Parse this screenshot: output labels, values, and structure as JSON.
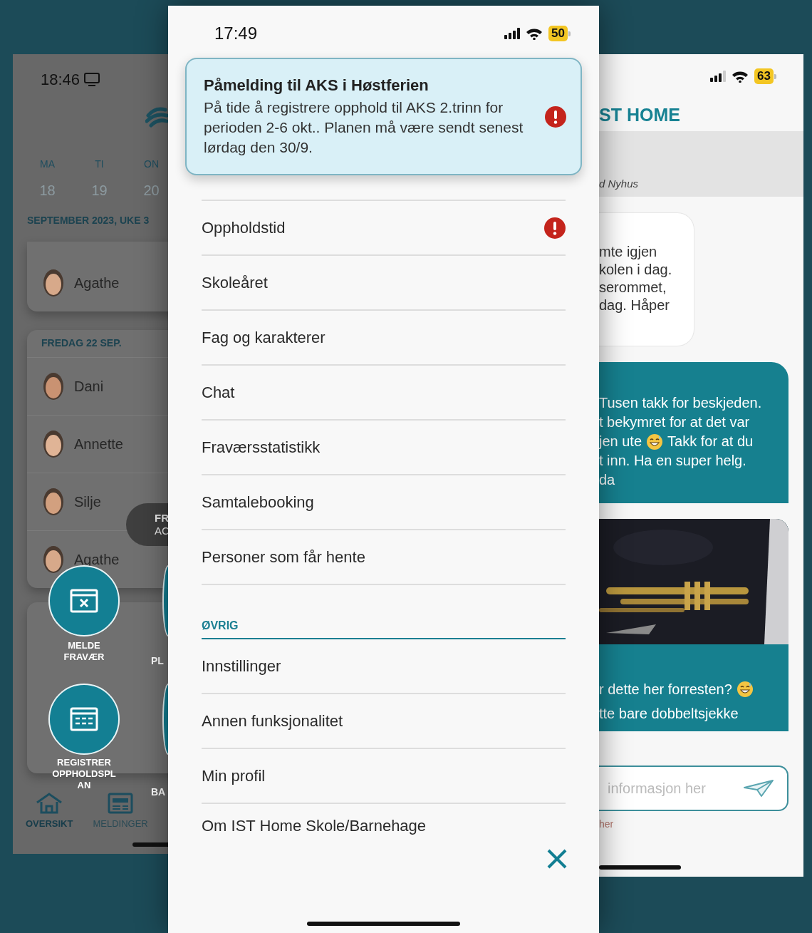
{
  "left_screen": {
    "status_time": "18:46",
    "weekdays": [
      {
        "day": "MA",
        "date": "18"
      },
      {
        "day": "TI",
        "date": "19"
      },
      {
        "day": "ON",
        "date": "20"
      }
    ],
    "week_label": "SEPTEMBER 2023, UKE 3",
    "day_cards": [
      {
        "rows": [
          {
            "name": "Agathe"
          }
        ]
      },
      {
        "header": "FREDAG 22 SEP.",
        "rows": [
          {
            "name": "Dani"
          },
          {
            "name": "Annette"
          },
          {
            "name": "Silje"
          },
          {
            "name": "Agathe"
          }
        ]
      }
    ],
    "pill": {
      "line_1": "FR",
      "line_2": "AC"
    },
    "quick_actions": [
      {
        "kind": "absence",
        "label": "MELDE FRAVÆR"
      },
      {
        "kind": "plan",
        "label": "REGISTRER OPPHOLDSPLAN"
      }
    ],
    "quick_actions_cut": [
      {
        "label": "PL"
      },
      {
        "label": "BA"
      }
    ],
    "tabs": [
      {
        "kind": "home",
        "label": "OVERSIKT",
        "selected": true
      },
      {
        "kind": "news",
        "label": "MELDINGER",
        "selected": false
      }
    ]
  },
  "center_screen": {
    "status_time": "17:49",
    "battery": "50",
    "banner": {
      "title": "Påmelding til AKS i Høstferien",
      "body": "På tide å registrere opphold til AKS 2.trinn for perioden 2-6 okt.. Planen må være sendt senest lørdag den 30/9.",
      "alert": true
    },
    "menu": [
      {
        "label": "Oppholdstid",
        "alert": true
      },
      {
        "label": "Skoleåret",
        "alert": false
      },
      {
        "label": "Fag og karakterer",
        "alert": false
      },
      {
        "label": "Chat",
        "alert": false
      },
      {
        "label": "Fraværsstatistikk",
        "alert": false
      },
      {
        "label": "Samtalebooking",
        "alert": false
      },
      {
        "label": "Personer som får hente",
        "alert": false
      }
    ],
    "section": {
      "title": "ØVRIG",
      "items": [
        {
          "label": "Innstillinger",
          "alert": false
        },
        {
          "label": "Annen funksjonalitet",
          "alert": false
        },
        {
          "label": "Min profil",
          "alert": false
        },
        {
          "label": "Om IST Home Skole/Barnehage",
          "alert": false
        }
      ]
    }
  },
  "right_screen": {
    "battery": "63",
    "logo": "ST HOME",
    "sender": "d Nyhus",
    "messages": [
      {
        "kind": "received",
        "lines": [
          [
            "mte igjen"
          ],
          [
            "kolen i dag."
          ],
          [
            "serommet,"
          ],
          [
            "dag. Håper"
          ]
        ]
      },
      {
        "kind": "sent",
        "lines": [
          [
            "Tusen takk for beskjeden."
          ],
          [
            "t bekymret for at det var"
          ],
          [
            "jen ute",
            {
              "kind": "emoji"
            },
            "Takk for at du"
          ],
          [
            "t inn. Ha en super helg."
          ],
          [
            "da"
          ]
        ]
      },
      {
        "kind": "sent_photo",
        "lines": [
          [
            "r dette her forresten?",
            {
              "kind": "emoji"
            }
          ],
          [
            "tte bare dobbeltsjekke"
          ]
        ]
      }
    ],
    "composer": {
      "placeholder": "informasjon her"
    },
    "hint": "her"
  }
}
